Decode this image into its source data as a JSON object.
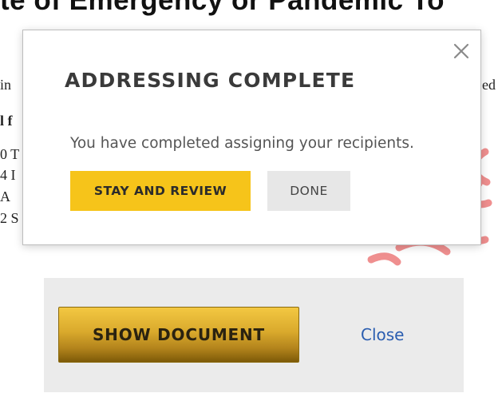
{
  "document": {
    "heading": "te of Emergency or Pandemic To",
    "fragments_left": [
      "in",
      "l f",
      "0 T",
      "4 I",
      "A",
      "2 S"
    ],
    "fragment_right": "ed"
  },
  "modal": {
    "title": "ADDRESSING COMPLETE",
    "message": "You have completed assigning your recipients.",
    "stay_label": "STAY AND REVIEW",
    "done_label": "DONE",
    "close_glyph": "✕"
  },
  "bottom_bar": {
    "show_document_label": "SHOW DOCUMENT",
    "close_link_label": "Close"
  },
  "colors": {
    "primary_button": "#f6c41a",
    "secondary_button": "#e7e7e7",
    "link": "#2a5db0",
    "stamp_red": "#ef8f8f"
  }
}
